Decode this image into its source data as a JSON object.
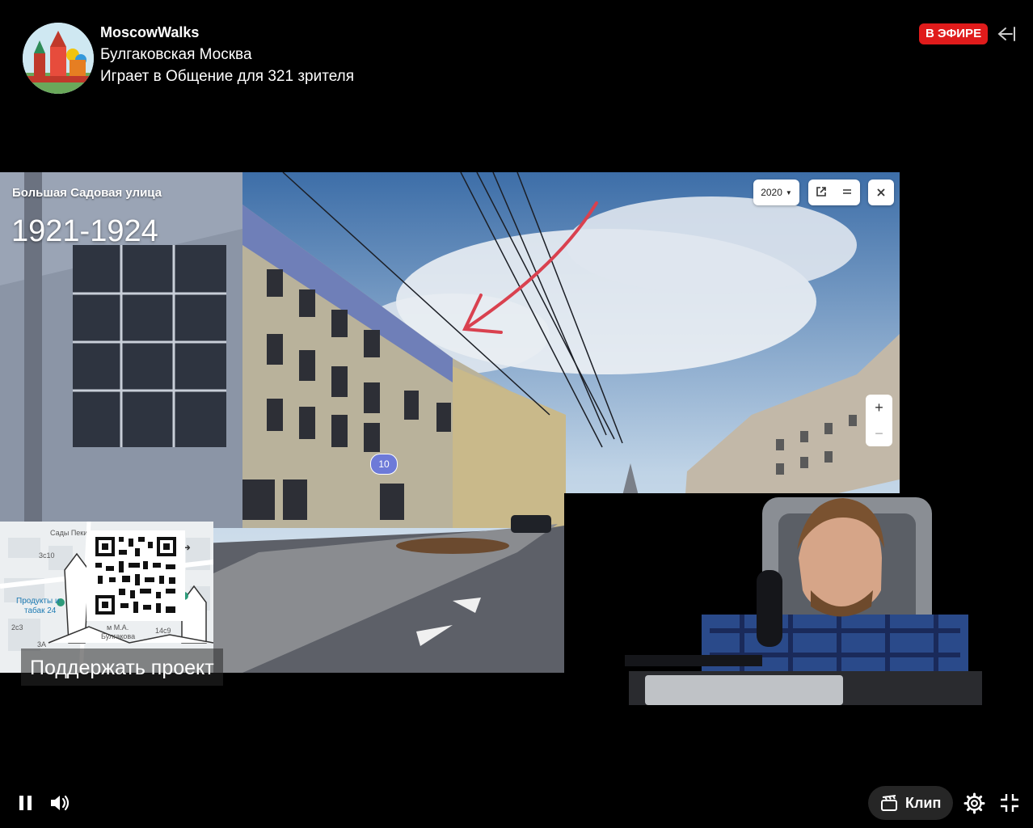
{
  "header": {
    "channel_name": "MoscowWalks",
    "stream_title": "Булгаковская Москва",
    "stream_subtitle": "Играет в Общение для 321 зрителя",
    "live_badge": "В ЭФИРЕ"
  },
  "panorama": {
    "street_name": "Большая Садовая улица",
    "years_overlay": "1921-1924",
    "year_select": "2020",
    "zoom_in": "+",
    "zoom_out": "−",
    "house_number": "10"
  },
  "mini_map": {
    "labels": [
      "Сады Пекин",
      "3с10",
      "Продукты и",
      "табак 24",
      "2с3",
      "3А",
      "Булгакова",
      "м М.А.",
      "14с9"
    ]
  },
  "support_text": "Поддержать проект",
  "controls": {
    "clip_label": "Клип"
  },
  "colors": {
    "live_badge": "#e01b1b",
    "arrow": "#d9414f",
    "house_badge": "#6d7ad8"
  }
}
